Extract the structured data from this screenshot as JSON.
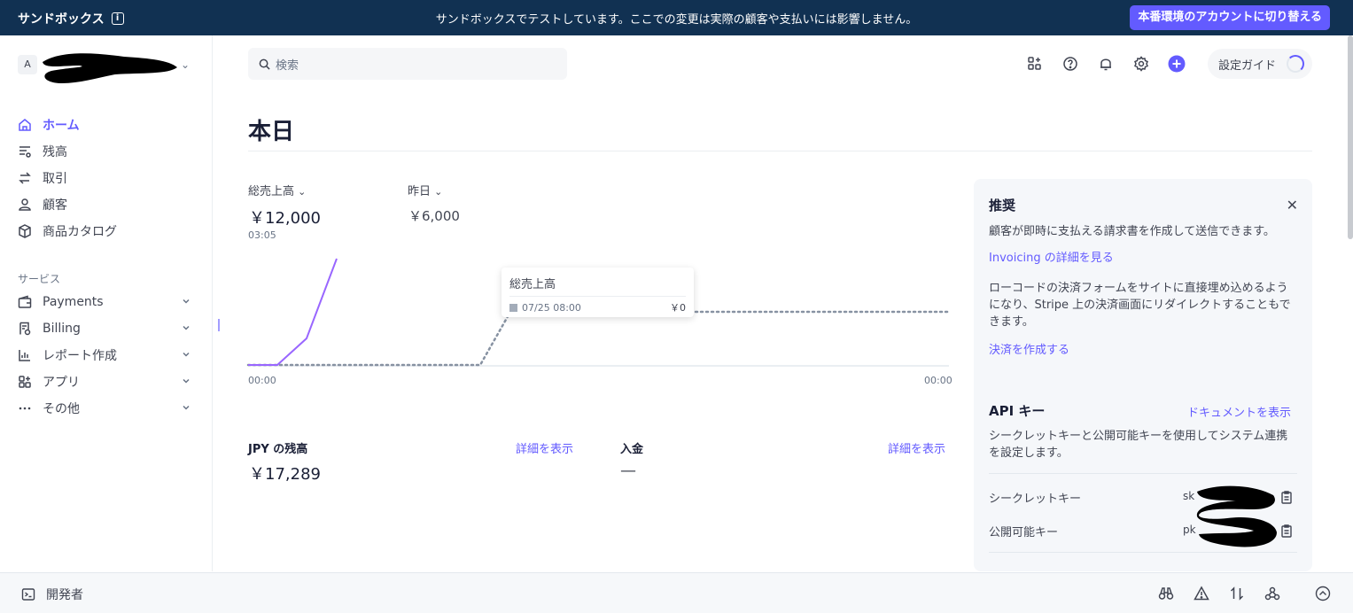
{
  "banner": {
    "brand": "サンドボックス",
    "message": "サンドボックスでテストしています。ここでの変更は実際の顧客や支払いには影響しません。",
    "live_button": "本番環境のアカウントに切り替える"
  },
  "account": {
    "avatar_letter": "A"
  },
  "sidebar": {
    "items": [
      {
        "label": "ホーム",
        "icon": "home-icon"
      },
      {
        "label": "残高",
        "icon": "balance-icon"
      },
      {
        "label": "取引",
        "icon": "transactions-icon"
      },
      {
        "label": "顧客",
        "icon": "customer-icon"
      },
      {
        "label": "商品カタログ",
        "icon": "box-icon"
      }
    ],
    "section_label": "サービス",
    "services": [
      {
        "label": "Payments",
        "icon": "wallet-icon"
      },
      {
        "label": "Billing",
        "icon": "billing-icon"
      },
      {
        "label": "レポート作成",
        "icon": "chart-icon"
      },
      {
        "label": "アプリ",
        "icon": "apps-icon"
      },
      {
        "label": "その他",
        "icon": "more-icon"
      }
    ]
  },
  "search": {
    "placeholder": "検索"
  },
  "header": {
    "guide_label": "設定ガイド"
  },
  "page": {
    "title": "本日"
  },
  "metrics": {
    "gross_label": "総売上高",
    "gross_value": "￥12,000",
    "gross_time": "03:05",
    "compare_label": "昨日",
    "compare_value": "￥6,000"
  },
  "chart_data": {
    "type": "line",
    "x_tick_labels": [
      "00:00",
      "00:00"
    ],
    "series": [
      {
        "name": "総売上高",
        "color": "#9966ff",
        "style": "solid",
        "values": [
          0,
          0,
          3000,
          12000
        ]
      },
      {
        "name": "昨日",
        "color": "#8792a2",
        "style": "dotted",
        "values": [
          0,
          0,
          0,
          0,
          0,
          6000,
          6000,
          6000,
          6000,
          6000
        ]
      }
    ],
    "ylim": [
      0,
      12000
    ],
    "tooltip": {
      "title": "総売上高",
      "time": "07/25 08:00",
      "value": "￥0"
    }
  },
  "balance": {
    "label": "JPY の残高",
    "value": "￥17,289",
    "link": "詳細を表示"
  },
  "payout": {
    "label": "入金",
    "value": "—",
    "link": "詳細を表示"
  },
  "panel": {
    "title": "推奨",
    "rec1_text": "顧客が即時に支払える請求書を作成して送信できます。",
    "rec1_link": "Invoicing の詳細を見る",
    "rec2_text": "ローコードの決済フォームをサイトに直接埋め込めるようになり、Stripe 上の決済画面にリダイレクトすることもできます。",
    "rec2_link": "決済を作成する",
    "api_title": "API キー",
    "api_docs_link": "ドキュメントを表示",
    "api_text": "シークレットキーと公開可能キーを使用してシステム連携を設定します。",
    "secret_label": "シークレットキー",
    "secret_value": "sk",
    "publishable_label": "公開可能キー",
    "publishable_value": "pk"
  },
  "bottom": {
    "developer_label": "開発者"
  }
}
